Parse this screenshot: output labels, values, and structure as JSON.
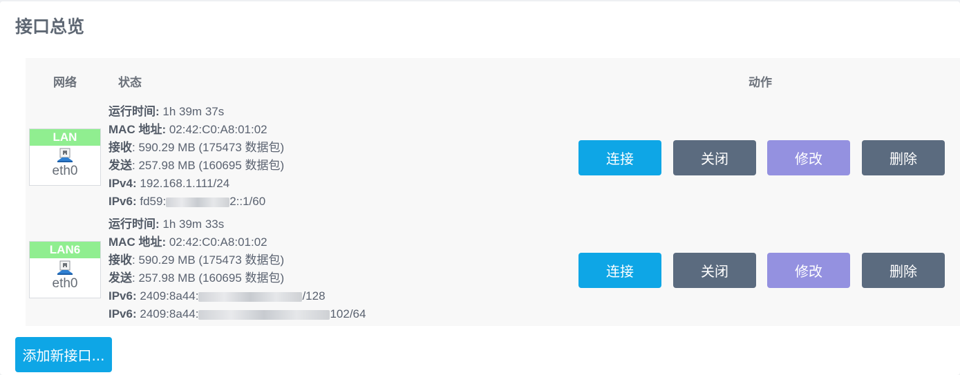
{
  "page": {
    "title": "接口总览",
    "add_button": "添加新接口..."
  },
  "table": {
    "headers": {
      "network": "网络",
      "status": "状态",
      "actions": "动作"
    }
  },
  "interfaces": [
    {
      "name": "LAN",
      "badge_color": "#90ee90",
      "device": "eth0",
      "device_icon": "ethernet-port-icon",
      "status": [
        {
          "key": "运行时间:",
          "value": " 1h 39m 37s"
        },
        {
          "key": "MAC 地址:",
          "value": " 02:42:C0:A8:01:02"
        },
        {
          "key": "接收",
          "value": ": 590.29 MB (175473 数据包)"
        },
        {
          "key": "发送",
          "value": ": 257.98 MB (160695 数据包)"
        },
        {
          "key": "IPv4:",
          "value": " 192.168.1.111/24"
        },
        {
          "key": "IPv6:",
          "value_pre": " fd59:",
          "value_post": "2::1/60"
        }
      ],
      "actions": {
        "connect": "连接",
        "close": "关闭",
        "edit": "修改",
        "delete": "删除"
      }
    },
    {
      "name": "LAN6",
      "badge_color": "#90ee90",
      "device": "eth0",
      "device_icon": "ethernet-port-icon",
      "status": [
        {
          "key": "运行时间:",
          "value": " 1h 39m 33s"
        },
        {
          "key": "MAC 地址:",
          "value": " 02:42:C0:A8:01:02"
        },
        {
          "key": "接收",
          "value": ": 590.29 MB (175473 数据包)"
        },
        {
          "key": "发送",
          "value": ": 257.98 MB (160695 数据包)"
        },
        {
          "key": "IPv6:",
          "value_pre": " 2409:8a44:",
          "value_post": "/128"
        },
        {
          "key": "IPv6:",
          "value_pre": " 2409:8a44:",
          "value_post": "102/64"
        }
      ],
      "actions": {
        "connect": "连接",
        "close": "关闭",
        "edit": "修改",
        "delete": "删除"
      }
    }
  ],
  "colors": {
    "primary": "#0ea6e6",
    "neutral": "#5b6b7f",
    "edit": "#9491e0",
    "badge": "#90ee90"
  }
}
